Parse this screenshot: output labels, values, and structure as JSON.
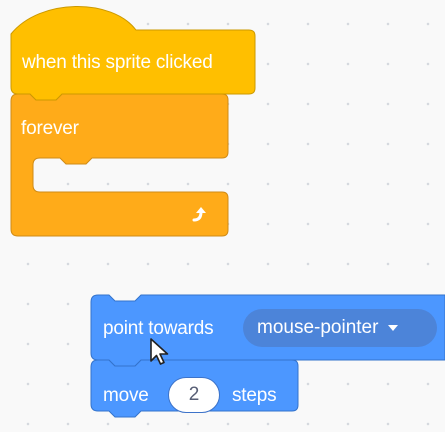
{
  "workspace": {
    "background": "#f9f9f9",
    "grid_dot_color": "#d5d9df"
  },
  "event_script": {
    "hat_block": {
      "label": "when this sprite clicked",
      "color": "#ffbf00"
    },
    "forever_block": {
      "label": "forever",
      "color": "#ffab19",
      "icon": "loop-arrow-icon"
    }
  },
  "motion_script": {
    "color": "#4c97ff",
    "point_towards_block": {
      "label": "point towards",
      "dropdown_value": "mouse-pointer",
      "dropdown_icon": "chevron-down-icon"
    },
    "move_block": {
      "label_before": "move",
      "steps_value": "2",
      "label_after": "steps"
    }
  },
  "cursor": {
    "icon": "mouse-pointer-icon"
  }
}
